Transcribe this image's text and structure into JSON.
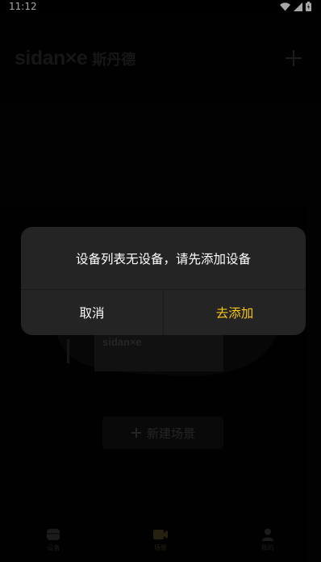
{
  "status_bar": {
    "time": "11:12",
    "wifi_icon": "wifi-icon",
    "signal_icon": "signal-icon",
    "battery_icon": "battery-icon"
  },
  "header": {
    "brand_word": "sidan×e",
    "brand_cn": "斯丹德",
    "add_icon": "plus-icon"
  },
  "main": {
    "illustration_brand": "sidan×e",
    "new_scene_label": "新建场景",
    "new_scene_icon": "plus-icon"
  },
  "tabbar": {
    "tabs": [
      {
        "label": "设备",
        "icon": "device-icon",
        "active": false
      },
      {
        "label": "场景",
        "icon": "scene-icon",
        "active": true
      },
      {
        "label": "我的",
        "icon": "user-icon",
        "active": false
      }
    ]
  },
  "dialog": {
    "message": "设备列表无设备，请先添加设备",
    "cancel_label": "取消",
    "confirm_label": "去添加"
  },
  "colors": {
    "accent": "#f5c518",
    "dialog_bg": "#242424",
    "background": "#000000"
  }
}
